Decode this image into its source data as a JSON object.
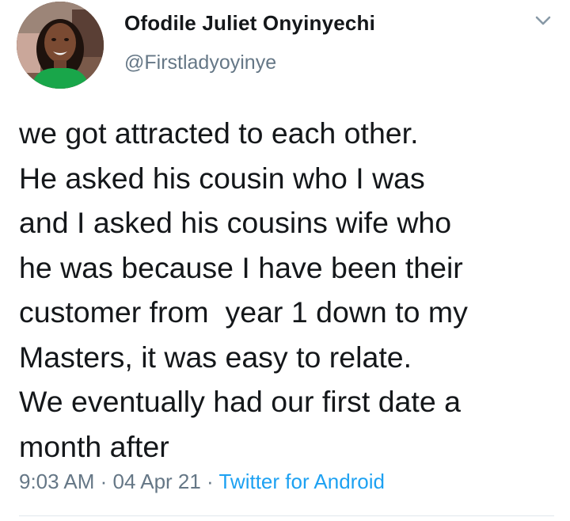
{
  "author": {
    "display_name": "Ofodile Juliet Onyinyechi",
    "handle": "@Firstladyoyinye"
  },
  "tweet": {
    "lines": [
      "we got attracted to each other.",
      "He asked his cousin who I was",
      "and I asked his cousins wife who",
      "he was because I have been their",
      "customer from  year 1 down to my",
      "Masters, it was easy to relate.",
      "We eventually had our first date a",
      "month after"
    ]
  },
  "meta": {
    "time": "9:03 AM",
    "separator": " · ",
    "date": "04 Apr 21",
    "source": "Twitter for Android"
  },
  "icons": {
    "menu": "chevron-down-icon"
  },
  "colors": {
    "text": "#14171a",
    "secondary": "#657786",
    "link": "#1da1f2",
    "divider": "#e1e8ed"
  }
}
